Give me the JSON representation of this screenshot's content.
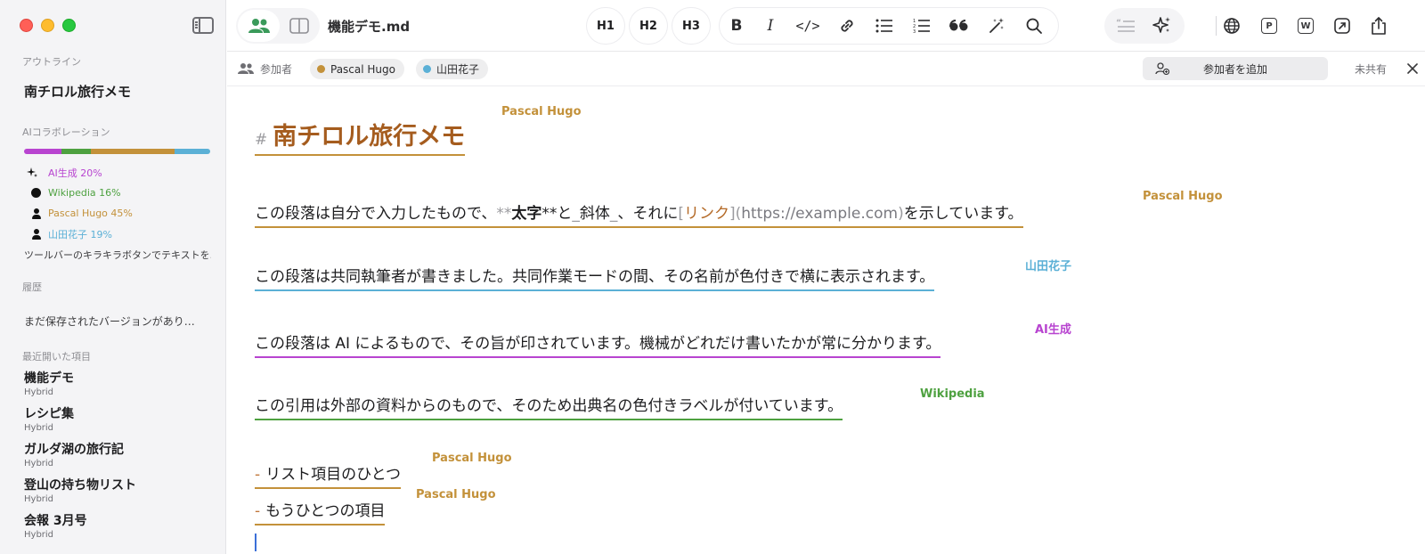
{
  "colors": {
    "pascal": "#c3913a",
    "yamada": "#5bb0d6",
    "ai": "#b844d0",
    "wikipedia": "#4ea140",
    "heading": "#a55c1e"
  },
  "toolbar": {
    "doc_name": "機能デモ.md",
    "h1": "H1",
    "h2": "H2",
    "h3": "H3",
    "bold": "B",
    "italic": "I",
    "code": "</>",
    "p_label": "P",
    "w_label": "W"
  },
  "sidebar": {
    "outline_label": "アウトライン",
    "outline_title": "南チロル旅行メモ",
    "ai_collab_label": "AIコラボレーション",
    "ai_bar": [
      {
        "name": "AI生成",
        "percent": 20,
        "color": "#b844d0"
      },
      {
        "name": "Wikipedia",
        "percent": 16,
        "color": "#4ea140"
      },
      {
        "name": "Pascal Hugo",
        "percent": 45,
        "color": "#c3913a"
      },
      {
        "name": "山田花子",
        "percent": 19,
        "color": "#5bb0d6"
      }
    ],
    "legend": [
      {
        "label": "AI生成 20%",
        "icon": "sparkle-icon",
        "color": "#b844d0"
      },
      {
        "label": "Wikipedia 16%",
        "icon": "circle-icon",
        "color": "#4ea140"
      },
      {
        "label": "Pascal Hugo 45%",
        "icon": "person-icon",
        "color": "#c3913a"
      },
      {
        "label": "山田花子 19%",
        "icon": "person-icon",
        "color": "#5bb0d6"
      }
    ],
    "hint": "ツールバーのキラキラボタンでテキストを...",
    "history_label": "履歴",
    "history_empty": "まだ保存されたバージョンがあり…",
    "recent_label": "最近開いた項目",
    "recents": [
      {
        "name": "機能デモ",
        "mode": "Hybrid"
      },
      {
        "name": "レシピ集",
        "mode": "Hybrid"
      },
      {
        "name": "ガルダ湖の旅行記",
        "mode": "Hybrid"
      },
      {
        "name": "登山の持ち物リスト",
        "mode": "Hybrid"
      },
      {
        "name": "会報 3月号",
        "mode": "Hybrid"
      }
    ]
  },
  "participants": {
    "label": "参加者",
    "chips": [
      {
        "name": "Pascal Hugo",
        "color": "#c3913a"
      },
      {
        "name": "山田花子",
        "color": "#5bb0d6"
      }
    ],
    "add_button": "参加者を追加",
    "status": "未共有"
  },
  "editor": {
    "heading": {
      "hash": "#",
      "text": "南チロル旅行メモ",
      "author": "Pascal Hugo"
    },
    "p1": {
      "t1": "この段落は自分で入力したもので、",
      "m1": "**",
      "b": "太字",
      "m2": "**と",
      "m3": "_",
      "i": "斜体",
      "m4": "_",
      "t2": "、それに",
      "m5": "[",
      "link": "リンク",
      "m6": "](",
      "url": "https://example.com",
      "m7": ")",
      "t3": "を示しています。",
      "author": "Pascal Hugo"
    },
    "p2": {
      "text": "この段落は共同執筆者が書きました。共同作業モードの間、その名前が色付きで横に表示されます。",
      "author": "山田花子"
    },
    "p3": {
      "text": "この段落は AI によるもので、その旨が印されています。機械がどれだけ書いたかが常に分かります。",
      "author": "AI生成"
    },
    "p4": {
      "text": "この引用は外部の資料からのもので、そのため出典名の色付きラベルが付いています。",
      "author": "Wikipedia"
    },
    "list": [
      {
        "marker": "-",
        "text": "リスト項目のひとつ",
        "author": "Pascal Hugo"
      },
      {
        "marker": "-",
        "text": "もうひとつの項目",
        "author": "Pascal Hugo"
      }
    ]
  }
}
